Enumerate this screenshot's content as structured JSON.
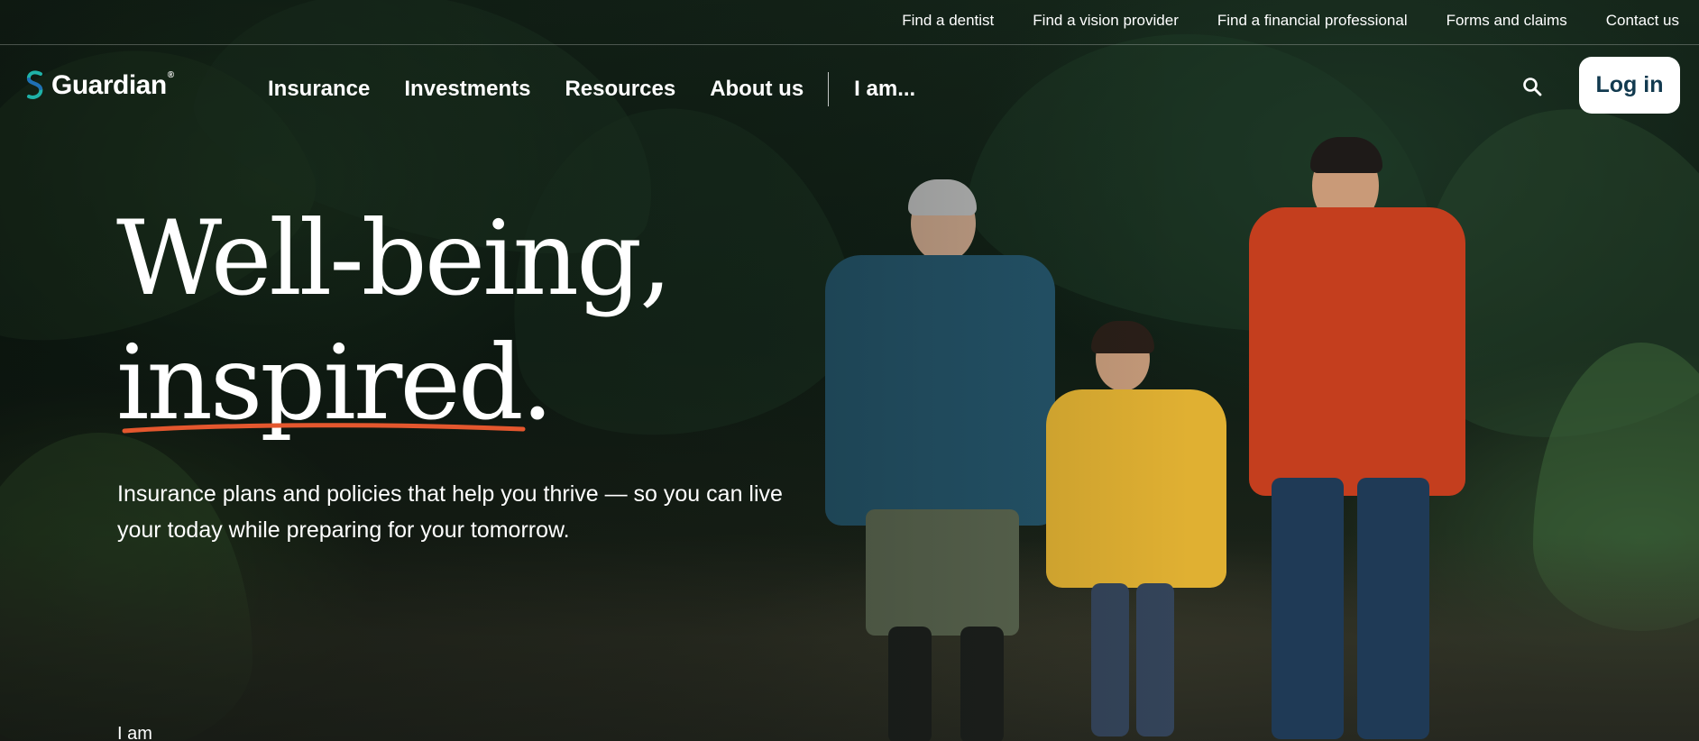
{
  "utility_bar": {
    "links": [
      {
        "label": "Find a dentist"
      },
      {
        "label": "Find a vision provider"
      },
      {
        "label": "Find a financial professional"
      },
      {
        "label": "Forms and claims"
      },
      {
        "label": "Contact us"
      }
    ]
  },
  "header": {
    "logo_text": "Guardian",
    "logo_mark": "®",
    "nav_items": [
      {
        "label": "Insurance"
      },
      {
        "label": "Investments"
      },
      {
        "label": "Resources"
      },
      {
        "label": "About us"
      }
    ],
    "persona_nav": "I am...",
    "search_icon": "search-icon",
    "login_label": "Log in"
  },
  "hero": {
    "title_line1": "Well-being,",
    "title_line2": "inspired.",
    "subtitle": "Insurance plans and policies that help you thrive — so you can live your today while preparing for your tomorrow.",
    "selector_label": "I am"
  },
  "colors": {
    "accent_underline": "#e4572e",
    "logo_teal": "#1fb2a8",
    "logo_blue": "#1f6fb5",
    "login_text": "#123a4f"
  }
}
